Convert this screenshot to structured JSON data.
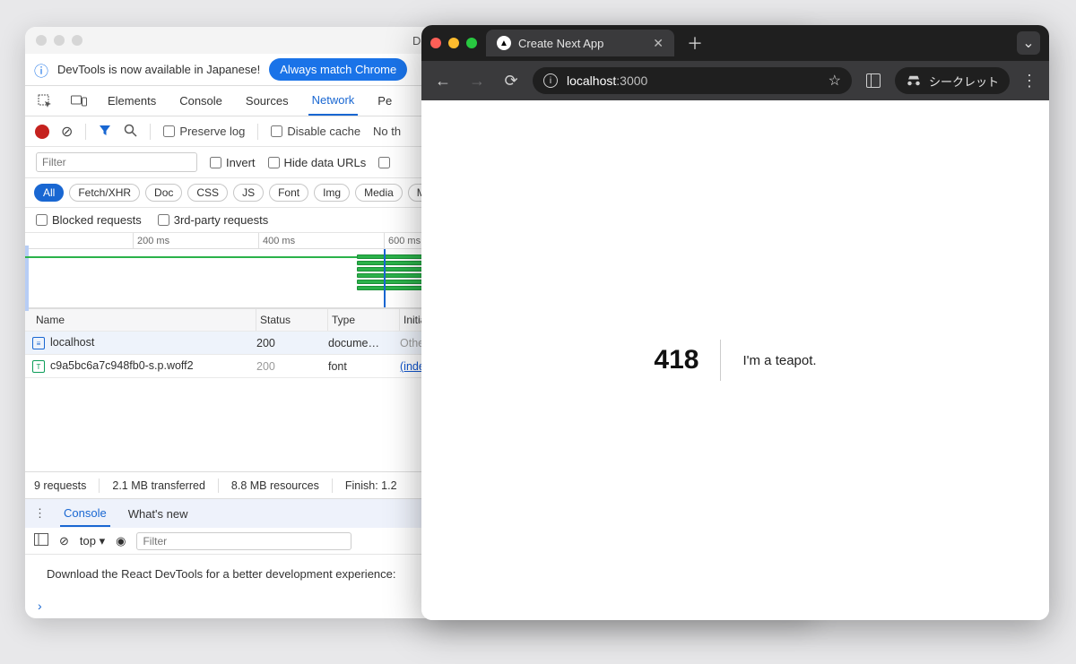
{
  "devtools": {
    "title": "DevTools - l",
    "infobar": {
      "text": "DevTools is now available in Japanese!",
      "pill": "Always match Chrome"
    },
    "tabs": [
      "Elements",
      "Console",
      "Sources",
      "Network",
      "Pe"
    ],
    "active_tab": "Network",
    "toolbar": {
      "preserve_log": "Preserve log",
      "disable_cache": "Disable cache",
      "no_throttle": "No th"
    },
    "filterbar": {
      "filter_placeholder": "Filter",
      "invert": "Invert",
      "hide_data_urls": "Hide data URLs"
    },
    "type_filters": [
      "All",
      "Fetch/XHR",
      "Doc",
      "CSS",
      "JS",
      "Font",
      "Img",
      "Media",
      "Manife"
    ],
    "active_type": "All",
    "blockbar": {
      "blocked": "Blocked requests",
      "thirdparty": "3rd-party requests"
    },
    "timeline_ticks": [
      "200 ms",
      "400 ms",
      "600 ms"
    ],
    "table": {
      "headers": [
        "Name",
        "Status",
        "Type",
        "Initiat"
      ],
      "rows": [
        {
          "icon": "doc",
          "name": "localhost",
          "status": "200",
          "type": "docume…",
          "initiator": "Other",
          "sel": true
        },
        {
          "icon": "font",
          "name": "c9a5bc6a7c948fb0-s.p.woff2",
          "status": "200",
          "type": "font",
          "initiator": "(inde",
          "muted": true,
          "link": true
        }
      ]
    },
    "statusbar": {
      "requests": "9 requests",
      "transferred": "2.1 MB transferred",
      "resources": "8.8 MB resources",
      "finish": "Finish: 1.2"
    },
    "drawer": {
      "tabs": [
        "Console",
        "What's new"
      ],
      "active": "Console",
      "context": "top",
      "filter_placeholder": "Filter",
      "message": "Download the React DevTools for a better development experience:"
    }
  },
  "chrome": {
    "tab_title": "Create Next App",
    "url_host": "localhost",
    "url_path": ":3000",
    "incognito_label": "シークレット",
    "error_code": "418",
    "error_msg": "I'm a teapot."
  }
}
